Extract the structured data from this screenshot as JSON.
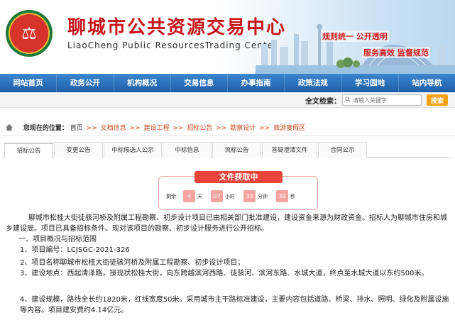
{
  "header": {
    "logo_symbol": "⚖",
    "title": "聊城市公共资源交易中心",
    "subtitle": "LiaoCheng Public ResourcesTrading Center",
    "slogan_1": "规则统一  公开透明",
    "slogan_2": "服务高效  监督规范",
    "colors": {
      "title": "#c8161d",
      "nav": "#1d5fa8",
      "accent": "#d0451b"
    }
  },
  "nav": {
    "items": [
      "网站首页",
      "政务公开",
      "机构概况",
      "交易信息",
      "办事指南",
      "政策法规",
      "学习园地",
      "站内导航"
    ]
  },
  "search": {
    "label": "全文检索：",
    "placeholder": "请输入关键字",
    "button_label": "搜索",
    "icon": "search-icon"
  },
  "breadcrumb": {
    "label": "您现在的位置：",
    "home": "首页",
    "items": [
      "文档信息",
      "建设工程",
      "招标公告",
      "勘察设计",
      "旅游度假区"
    ],
    "separator": ">>",
    "icon": "home-icon"
  },
  "tabs": {
    "items": [
      "招标公告",
      "变更公告",
      "中标候选人公示",
      "中标信息",
      "流标公告",
      "答疑澄清文件",
      "合同公示"
    ],
    "active_index": 0
  },
  "timer": {
    "title": "文件获取中",
    "prefix": "剩余：",
    "days": "4",
    "days_unit": "天",
    "hours": "07",
    "hours_unit": "小时",
    "minutes": "33",
    "minutes_unit": "分钟",
    "seconds": "39",
    "seconds_unit": "秒"
  },
  "content": {
    "intro": "聊城市松桂大街徒骇河桥及附属工程勘察、初步设计项目已由相关部门批准建设，建设资金来源为财政资金。招标人为聊城市住房和城乡建设局。项目已具备招标条件。现对该项目的勘察、初步设计服务进行公开招标。",
    "heading_1": "一、项目概况与招标范围",
    "item_1": "1、项目编号：LCJSGC-2021-326",
    "item_2": "2、项目名称聊城市松桂大街徒骇河桥及附属工程勘察、初步设计项目；",
    "item_3": "3、建设地点：西起清泽路，接现状松桂大街，向东跨越滨河西路、徒骇河、滨河东路、水城大道，终点至水城大道以东约500米。",
    "item_4": "4、建设规模，路线全长约1820米，红线宽度50米。采用城市主干路标准建设，主要内容包括道路、桥梁、排水、照明、绿化及附属设施等内容。项目建安费约4.14亿元。"
  }
}
